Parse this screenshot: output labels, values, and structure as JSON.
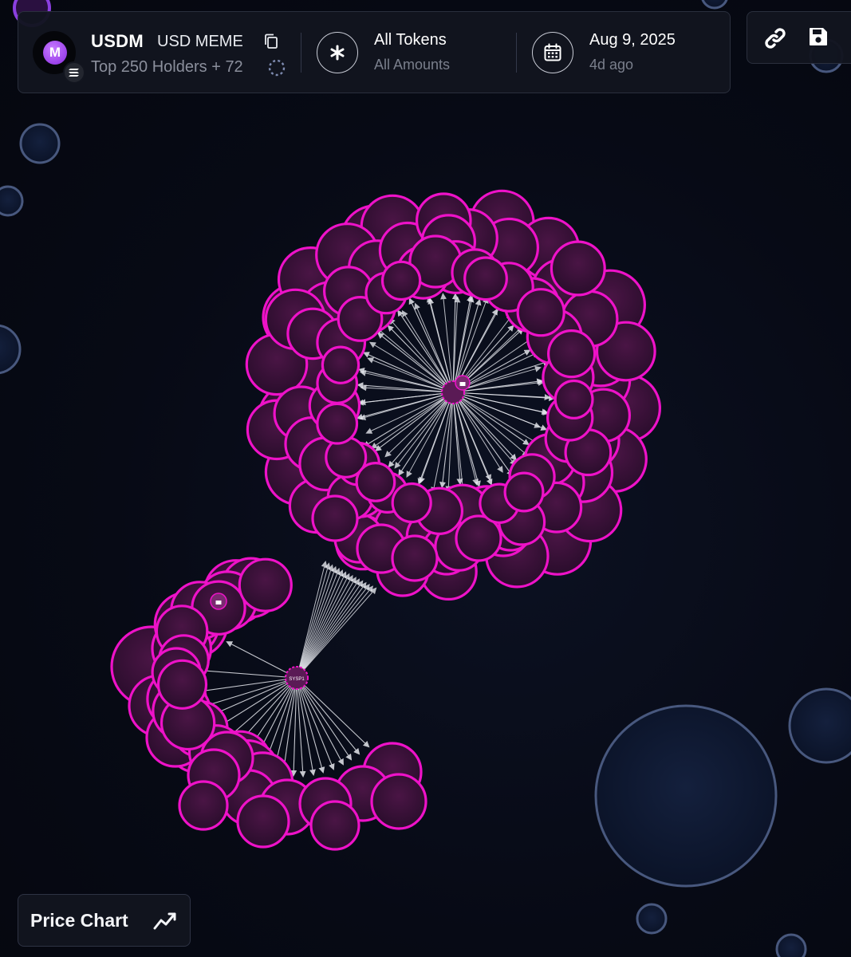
{
  "token": {
    "logo_letter": "M",
    "symbol": "USDM",
    "name": "USD MEME",
    "holders_label": "Top 250 Holders + 72",
    "chain_icon": "solana-icon",
    "copy_icon": "copy-icon"
  },
  "filters": {
    "tokens_title": "All Tokens",
    "tokens_sub": "All Amounts",
    "tokens_icon": "asterisk-icon",
    "date_title": "Aug 9, 2025",
    "date_sub": "4d ago",
    "date_icon": "calendar-icon"
  },
  "actions": {
    "link_icon": "link-icon",
    "save_icon": "save-icon"
  },
  "price_chart": {
    "label": "Price Chart",
    "icon": "trend-line-icon"
  },
  "graph": {
    "hub_label": "SYSP1",
    "colors": {
      "background": "#070a15",
      "cluster_stroke": "#ee12c8",
      "cluster_fill": "#3a1236",
      "neutral_stroke": "#48587e",
      "neutral_fill": "#0f1a33",
      "arrow": "#e6e8ee"
    }
  }
}
